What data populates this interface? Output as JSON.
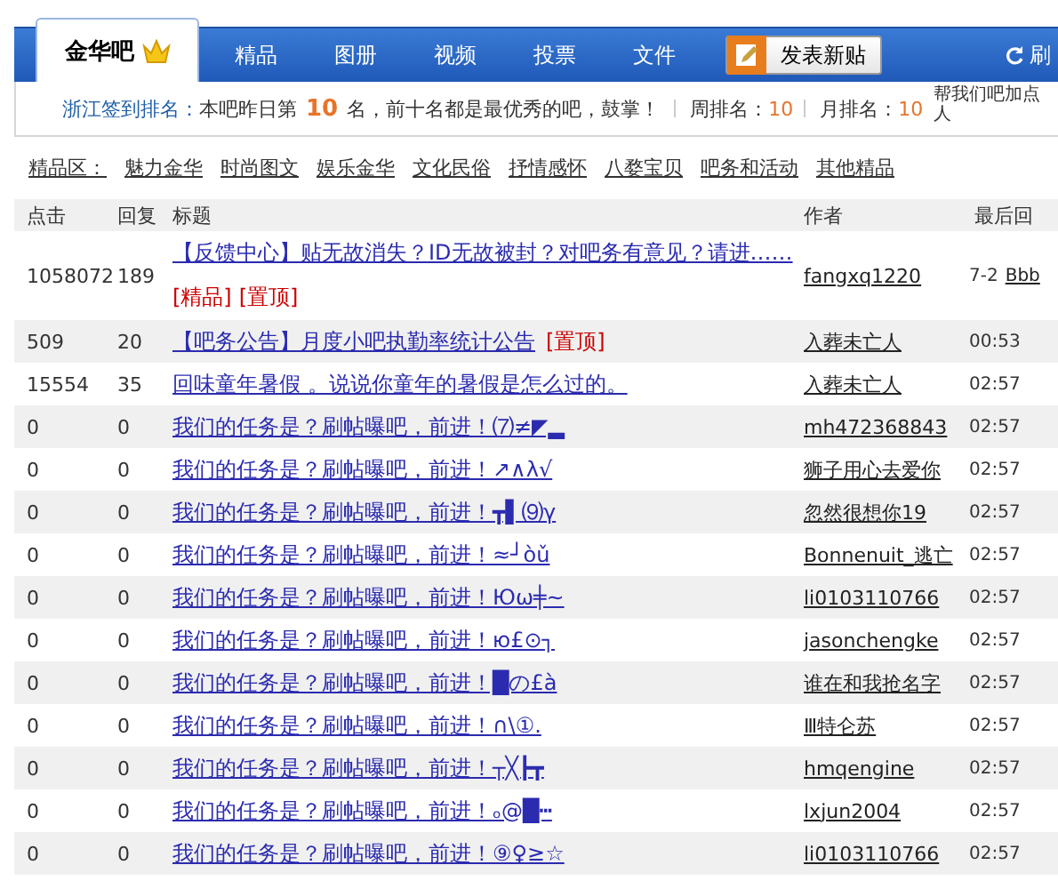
{
  "header": {
    "tabs": [
      {
        "label": "金华吧",
        "selected": true
      },
      {
        "label": "精品",
        "selected": false
      },
      {
        "label": "图册",
        "selected": false
      },
      {
        "label": "视频",
        "selected": false
      },
      {
        "label": "投票",
        "selected": false
      },
      {
        "label": "文件",
        "selected": false
      }
    ],
    "post_button": "发表新贴",
    "refresh": "刷"
  },
  "rank_bar": {
    "label": "浙江签到排名：",
    "before": "本吧昨日第",
    "rank": "10",
    "after": "名，前十名都是最优秀的吧，鼓掌！",
    "weekly_label": "周排名：",
    "weekly": "10",
    "monthly_label": "月排名：",
    "monthly": "10",
    "help": "帮我们吧加点人"
  },
  "featured_nav": {
    "label": "精品区：",
    "links": [
      "魅力金华",
      "时尚图文",
      "娱乐金华",
      "文化民俗",
      "抒情感怀",
      "八婺宝贝",
      "吧务和活动",
      "其他精品"
    ]
  },
  "table": {
    "columns": [
      "点击",
      "回复",
      "标题",
      "作者",
      "最后回"
    ],
    "rows": [
      {
        "clicks": "1058072",
        "replies": "189",
        "title": "【反馈中心】贴无故消失？ID无故被封？对吧务有意见？请进……",
        "tags": [
          "[精品]",
          "[置顶]"
        ],
        "author": "fangxq1220",
        "last": "7-2",
        "last_author": "Bbb"
      },
      {
        "clicks": "509",
        "replies": "20",
        "title": "【吧务公告】月度小吧执勤率统计公告",
        "tags": [
          "[置顶]"
        ],
        "author": "入葬未亡人",
        "last": "00:53"
      },
      {
        "clicks": "15554",
        "replies": "35",
        "title": "回味童年暑假 。说说你童年的暑假是怎么过的。",
        "tags": [],
        "author": "入葬未亡人",
        "last": "02:57"
      },
      {
        "clicks": "0",
        "replies": "0",
        "title": "我们的任务是？刷帖曝吧，前进！⑺≠◤▂",
        "tags": [],
        "author": "mh472368843",
        "last": "02:57"
      },
      {
        "clicks": "0",
        "replies": "0",
        "title": "我们的任务是？刷帖曝吧，前进！↗∧λ√",
        "tags": [],
        "author": "狮子用心去爱你",
        "last": "02:57"
      },
      {
        "clicks": "0",
        "replies": "0",
        "title": "我们的任务是？刷帖曝吧，前进！┳▌⑼γ",
        "tags": [],
        "author": "忽然很想你19",
        "last": "02:57"
      },
      {
        "clicks": "0",
        "replies": "0",
        "title": "我们的任务是？刷帖曝吧，前进！≈┘òǔ",
        "tags": [],
        "author": "Bonnenuit_逃亡",
        "last": "02:57"
      },
      {
        "clicks": "0",
        "replies": "0",
        "title": "我们的任务是？刷帖曝吧，前进！Юω╪~",
        "tags": [],
        "author": "li0103110766",
        "last": "02:57"
      },
      {
        "clicks": "0",
        "replies": "0",
        "title": "我们的任务是？刷帖曝吧，前进！ю£⊙┐",
        "tags": [],
        "author": "jasonchengke",
        "last": "02:57"
      },
      {
        "clicks": "0",
        "replies": "0",
        "title": "我们的任务是？刷帖曝吧，前进！█の£à",
        "tags": [],
        "author": "谁在和我抢名字",
        "last": "02:57"
      },
      {
        "clicks": "0",
        "replies": "0",
        "title": "我们的任务是？刷帖曝吧，前进！∩\\①.",
        "tags": [],
        "author": "Ⅲ特仑苏",
        "last": "02:57"
      },
      {
        "clicks": "0",
        "replies": "0",
        "title": "我们的任务是？刷帖曝吧，前进！┬╳┣┳",
        "tags": [],
        "author": "hmqengine",
        "last": "02:57"
      },
      {
        "clicks": "0",
        "replies": "0",
        "title": "我们的任务是？刷帖曝吧，前进！ₒ@█┅",
        "tags": [],
        "author": "lxjun2004",
        "last": "02:57"
      },
      {
        "clicks": "0",
        "replies": "0",
        "title": "我们的任务是？刷帖曝吧，前进！⑨♀≥☆",
        "tags": [],
        "author": "li0103110766",
        "last": "02:57"
      }
    ]
  }
}
